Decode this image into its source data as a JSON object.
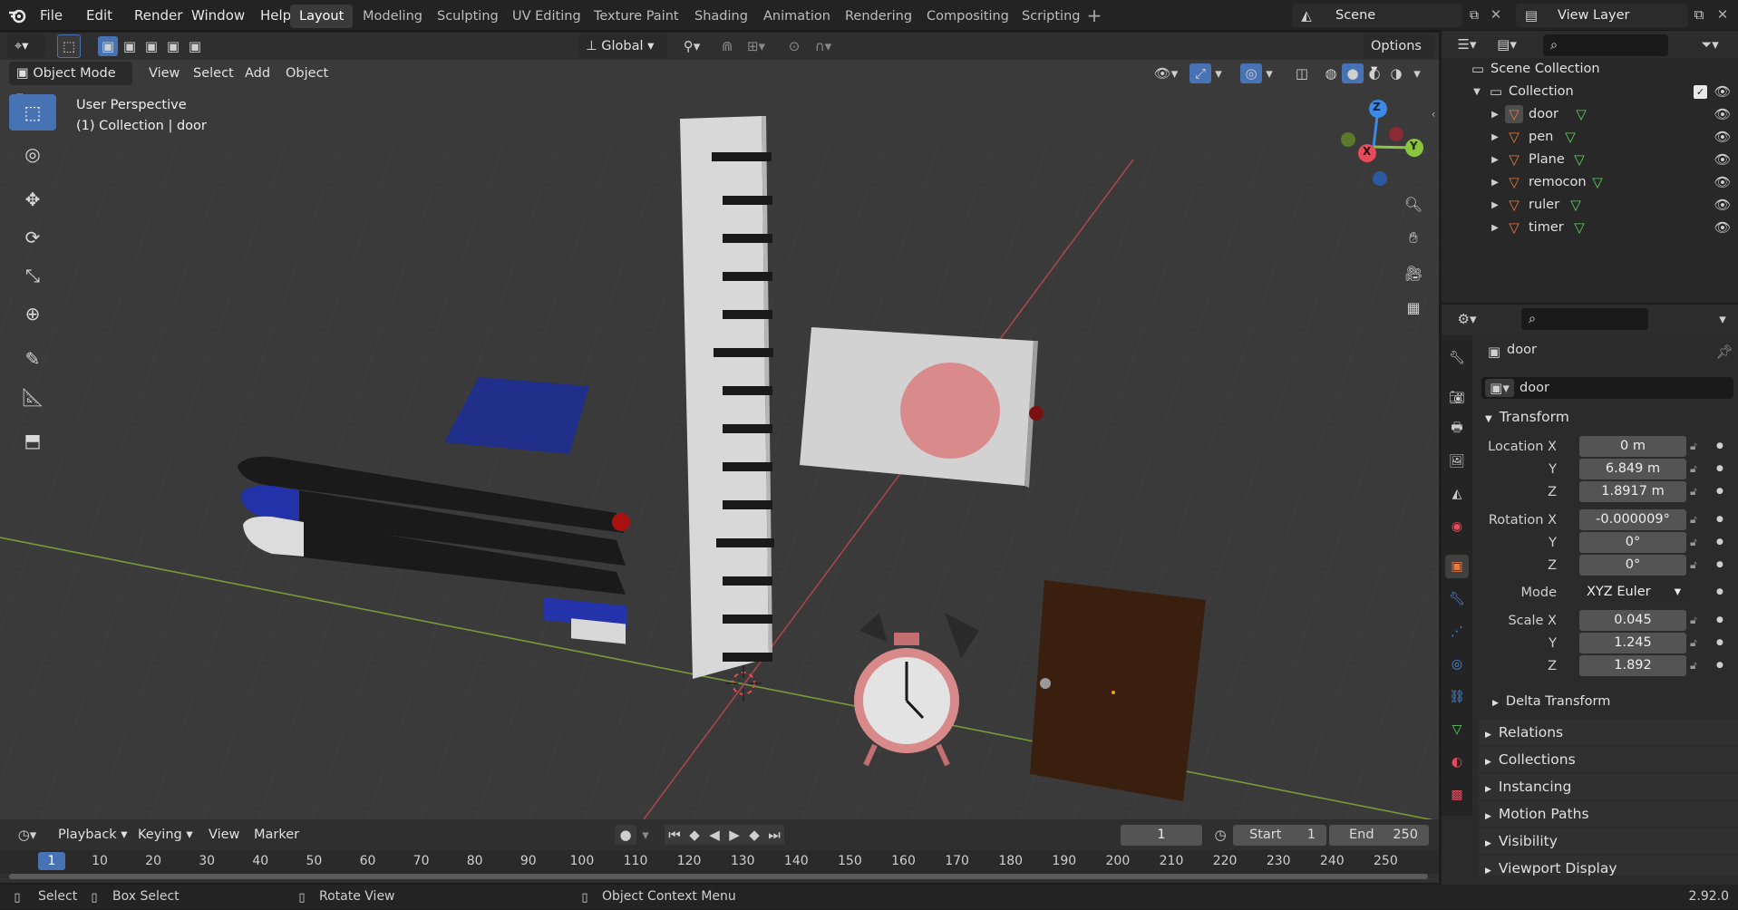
{
  "topbar": {
    "menus": [
      "File",
      "Edit",
      "Render",
      "Window",
      "Help"
    ],
    "workspaces": [
      "Layout",
      "Modeling",
      "Sculpting",
      "UV Editing",
      "Texture Paint",
      "Shading",
      "Animation",
      "Rendering",
      "Compositing",
      "Scripting"
    ],
    "active_workspace": "Layout",
    "scene_name": "Scene",
    "view_layer": "View Layer"
  },
  "viewport_header": {
    "transform_orientation": "Global",
    "options": "Options",
    "mode": "Object Mode",
    "menus": [
      "View",
      "Select",
      "Add",
      "Object"
    ]
  },
  "viewport": {
    "title": "User Perspective",
    "subtitle": "(1) Collection | door",
    "gizmo": {
      "x": "X",
      "y": "Y",
      "z": "Z"
    }
  },
  "outliner": {
    "root": "Scene Collection",
    "collection": "Collection",
    "items": [
      "door",
      "pen",
      "Plane",
      "remocon",
      "ruler",
      "timer"
    ]
  },
  "properties": {
    "object_name": "door",
    "data_name": "door",
    "transform_label": "Transform",
    "location_label": "Location X",
    "location": [
      "0 m",
      "6.849 m",
      "1.8917 m"
    ],
    "rotation_label": "Rotation X",
    "rotation": [
      "-0.000009°",
      "0°",
      "0°"
    ],
    "mode_label": "Mode",
    "mode": "XYZ Euler",
    "scale_label": "Scale X",
    "scale": [
      "0.045",
      "1.245",
      "1.892"
    ],
    "axis_y": "Y",
    "axis_z": "Z",
    "panels": [
      "Delta Transform",
      "Relations",
      "Collections",
      "Instancing",
      "Motion Paths",
      "Visibility",
      "Viewport Display"
    ]
  },
  "timeline": {
    "menus": [
      "Playback",
      "Keying",
      "View",
      "Marker"
    ],
    "current_frame": "1",
    "start_label": "Start",
    "start": "1",
    "end_label": "End",
    "end": "250",
    "ticks": [
      "10",
      "20",
      "30",
      "40",
      "50",
      "60",
      "70",
      "80",
      "90",
      "100",
      "110",
      "120",
      "130",
      "140",
      "150",
      "160",
      "170",
      "180",
      "190",
      "200",
      "210",
      "220",
      "230",
      "240",
      "250"
    ]
  },
  "statusbar": {
    "select": "Select",
    "box_select": "Box Select",
    "rotate_view": "Rotate View",
    "context_menu": "Object Context Menu",
    "version": "2.92.0"
  },
  "colors": {
    "accent": "#4772b3",
    "object_orange": "#e6793a",
    "mesh_green": "#5fd35f",
    "axis_x": "#e64b5c",
    "axis_y": "#8bc53f",
    "axis_z": "#3d8ae6"
  }
}
